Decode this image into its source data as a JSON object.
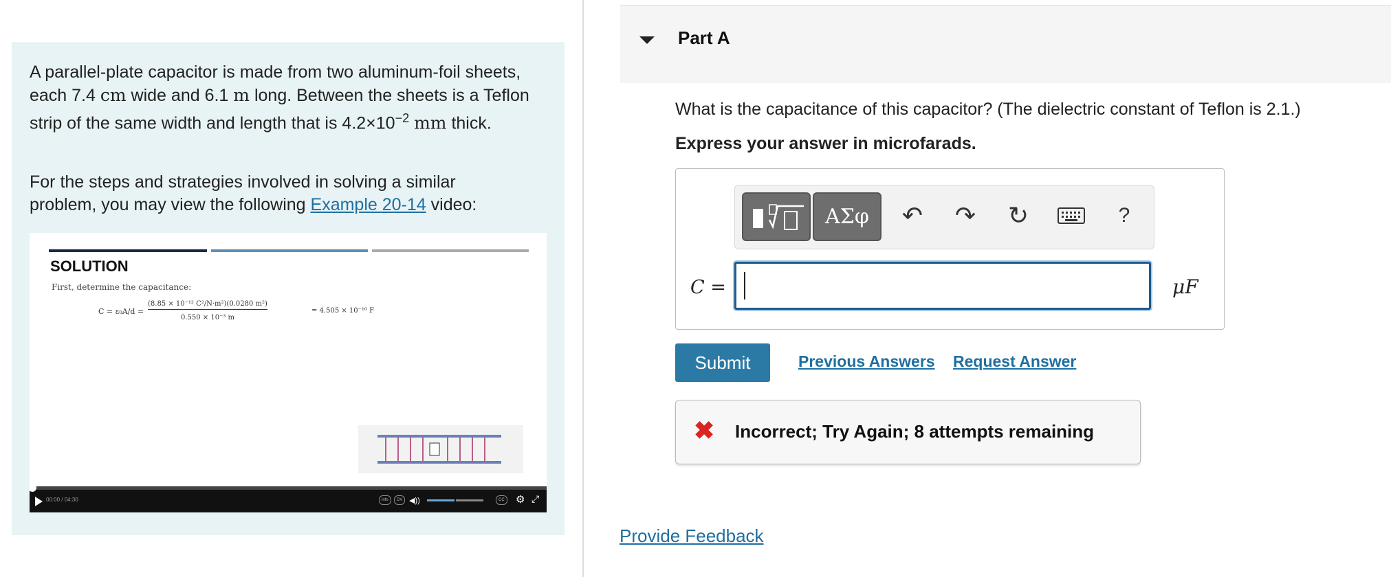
{
  "problem": {
    "p1_a": "A parallel-plate capacitor is made from two aluminum-foil sheets, each 7.4",
    "unit_cm": "cm",
    "p1_b": "wide and 6.1",
    "unit_m": "m",
    "p1_c": "long. Between the sheets is a Teflon strip of the same width and length that is 4.2×10",
    "exp": "−2",
    "unit_mm": "mm",
    "p1_d": "thick.",
    "p2_a": "For the steps and strategies involved in solving a similar problem, you may view the following",
    "p2_link": "Example 20-14",
    "p2_b": "video:"
  },
  "video": {
    "solution_label": "SOLUTION",
    "subtitle": "First, determine the capacitance:",
    "formula_lhs": "C = ε₀A/d =",
    "formula_num": "(8.85 × 10⁻¹² C²/N·m²)(0.0280 m²)",
    "formula_den": "0.550 × 10⁻³ m",
    "formula_result": "= 4.505 × 10⁻¹⁰ F",
    "time": "00:00 / 04:30"
  },
  "part": {
    "title": "Part A",
    "question": "What is the capacitance of this capacitor? (The dielectric constant of Teflon is 2.1.)",
    "instruction": "Express your answer in microfarads."
  },
  "toolbar": {
    "greek_label": "ΑΣφ",
    "help_label": "?"
  },
  "answer": {
    "variable": "C =",
    "value": "",
    "unit": "μF"
  },
  "actions": {
    "submit": "Submit",
    "previous": "Previous Answers",
    "request": "Request Answer"
  },
  "feedback": {
    "message": "Incorrect; Try Again; 8 attempts remaining"
  },
  "footer": {
    "provide_feedback": "Provide Feedback"
  }
}
